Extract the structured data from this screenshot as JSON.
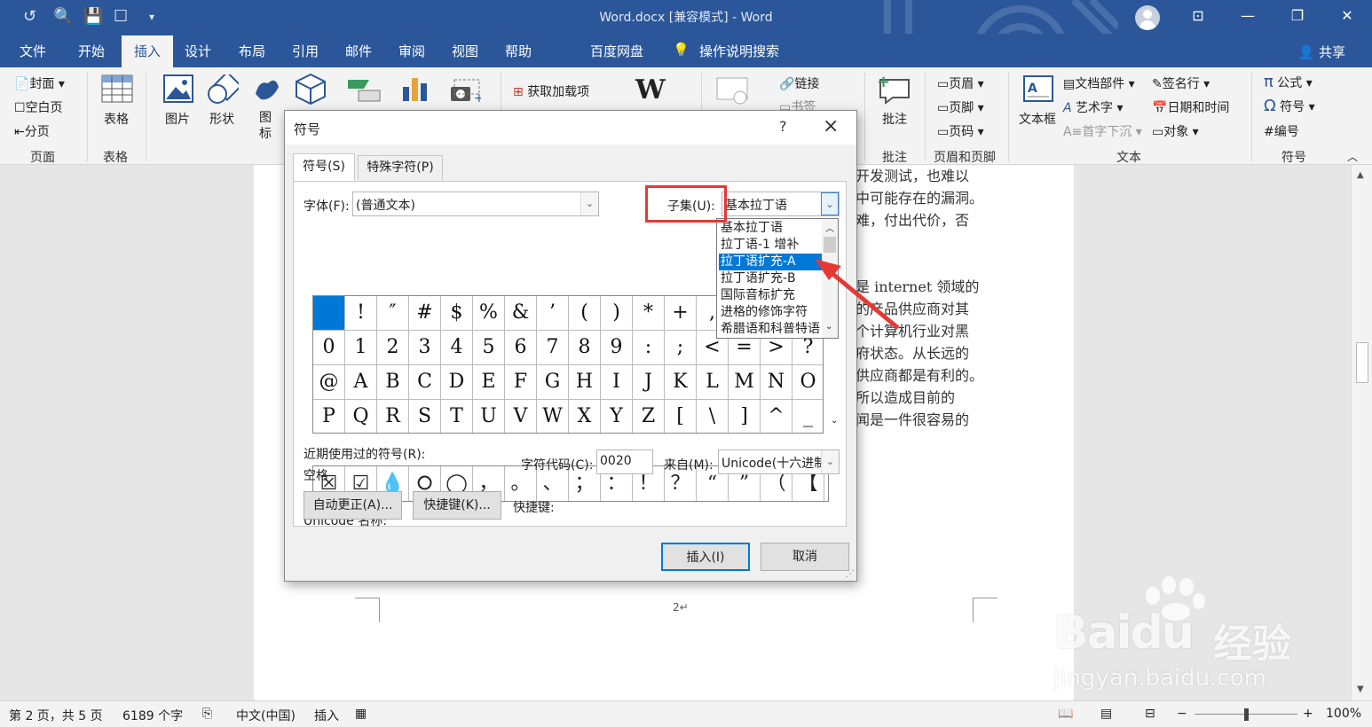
{
  "titlebar": {
    "title": "Word.docx [兼容模式] - Word"
  },
  "tabs": [
    "文件",
    "开始",
    "插入",
    "设计",
    "布局",
    "引用",
    "邮件",
    "审阅",
    "视图",
    "帮助",
    "百度网盘",
    "操作说明搜索"
  ],
  "share_label": "共享",
  "ribbon": {
    "cover": "封面",
    "blank_page": "空白页",
    "page_break": "分页",
    "group_pages": "页面",
    "table": "表格",
    "group_table": "表格",
    "picture": "图片",
    "shapes": "形状",
    "icons": "图标",
    "addins": "获取加载项",
    "link": "链接",
    "bookmark": "书签",
    "comment": "批注",
    "group_comment": "批注",
    "header": "页眉",
    "footer": "页脚",
    "page_number": "页码",
    "group_header_footer": "页眉和页脚",
    "textbox": "文本框",
    "quick_parts": "文档部件",
    "wordart": "艺术字",
    "dropcap": "首字下沉",
    "signature": "签名行",
    "datetime": "日期和时间",
    "object": "对象",
    "group_text": "文本",
    "equation": "公式",
    "symbol": "符号",
    "numbering": "编号",
    "group_symbols": "符号"
  },
  "document": {
    "lines": [
      "开发测试，也难以",
      "中可能存在的漏洞。",
      "难，付出代价，否",
      "是 internet 领域的",
      "的产品供应商对其",
      "个计算机行业对黑",
      "府状态。从长远的",
      "供应商都是有利的。",
      "所以造成目前的",
      "闻是一件很容易的"
    ],
    "page_num": "2↵"
  },
  "statusbar": {
    "page": "第 2 页，共 5 页",
    "words": "6189 个字",
    "language": "中文(中国)",
    "mode": "插入",
    "zoom": "100%"
  },
  "dialog": {
    "title": "符号",
    "help": "?",
    "tab_symbols": "符号(S)",
    "tab_special": "特殊字符(P)",
    "font_label": "字体(F):",
    "font_value": "(普通文本)",
    "subset_label": "子集(U):",
    "subset_value": "基本拉丁语",
    "subset_options": [
      "基本拉丁语",
      "拉丁语-1 增补",
      "拉丁语扩充-A",
      "拉丁语扩充-B",
      "国际音标扩充",
      "进格的修饰字符",
      "希腊语和科普特语"
    ],
    "symbol_grid": [
      " ",
      "!",
      "″",
      "#",
      "$",
      "%",
      "&",
      "’",
      "(",
      ")",
      "*",
      "+",
      ",",
      "-",
      ".",
      "/",
      "0",
      "1",
      "2",
      "3",
      "4",
      "5",
      "6",
      "7",
      "8",
      "9",
      ":",
      ";",
      "<",
      "=",
      ">",
      "?",
      "@",
      "A",
      "B",
      "C",
      "D",
      "E",
      "F",
      "G",
      "H",
      "I",
      "J",
      "K",
      "L",
      "M",
      "N",
      "O",
      "P",
      "Q",
      "R",
      "S",
      "T",
      "U",
      "V",
      "W",
      "X",
      "Y",
      "Z",
      "[",
      "\\",
      "]",
      "^",
      "_"
    ],
    "recent_label": "近期使用过的符号(R):",
    "recent_symbols": [
      "☒",
      "☑",
      "💧",
      "⭘",
      "◯",
      "，",
      "。",
      "、",
      "；",
      "：",
      "！",
      "？",
      "“",
      "”",
      "（",
      "【"
    ],
    "unicode_name_label": "Unicode 名称:",
    "unicode_name": "空格",
    "char_code_label": "字符代码(C):",
    "char_code": "0020",
    "from_label": "来自(M):",
    "from_value": "Unicode(十六进制)",
    "autocorrect_btn": "自动更正(A)...",
    "shortcut_btn": "快捷键(K)...",
    "shortcut_label": "快捷键:",
    "insert_btn": "插入(I)",
    "cancel_btn": "取消"
  },
  "watermark": {
    "brand": "Bai",
    "brand2": "du",
    "cn": "经验",
    "url": "jingyan.baidu.com"
  },
  "colors": {
    "accent": "#2b579a",
    "select": "#0078d7",
    "highlight": "#e53935"
  }
}
